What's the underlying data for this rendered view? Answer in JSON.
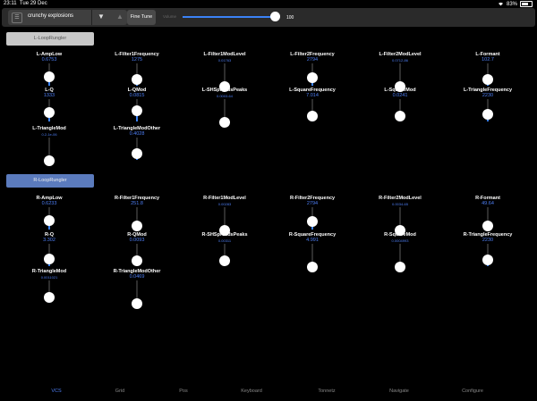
{
  "status_bar": {
    "time": "23:11",
    "date": "Tue 29 Dec",
    "battery": "83%"
  },
  "toolbar": {
    "preset_name": "crunchy explosions",
    "fine_tune_label": "Fine Tune",
    "slider_label": "Volume",
    "slider_value": "100",
    "slider_fraction": 1.0
  },
  "sections": {
    "left_button": "L-LoopRungler",
    "right_button": "R-LoopRungler"
  },
  "knobs_left": [
    {
      "label": "L-AmpLow",
      "value": "0.6753",
      "level": 0.5,
      "small": false
    },
    {
      "label": "L-Filter1Frequency",
      "value": "1275",
      "level": 0.35,
      "small": false
    },
    {
      "label": "L-Filter1ModLevel",
      "value": "0.01763",
      "level": 0.0,
      "small": true
    },
    {
      "label": "L-Filter2Frequency",
      "value": "2794",
      "level": 0.45,
      "small": false
    },
    {
      "label": "L-Filter2ModLevel",
      "value": "0.0712-86",
      "level": 0.0,
      "small": true
    },
    {
      "label": "L-Formant",
      "value": "102.7",
      "level": 0.35,
      "small": false
    },
    {
      "label": "L-Q",
      "value": "1333",
      "level": 0.5,
      "small": false
    },
    {
      "label": "L-QMod",
      "value": "0.0815",
      "level": 0.6,
      "small": false
    },
    {
      "label": "L-SHSpreadsPeaks",
      "value": "0.0003-64",
      "level": 0.0,
      "small": true
    },
    {
      "label": "L-SquareFrequency",
      "value": "7.014",
      "level": 0.3,
      "small": false
    },
    {
      "label": "L-SquareMod",
      "value": "0.0241",
      "level": 0.3,
      "small": false
    },
    {
      "label": "L-TriangleFrequency",
      "value": "2230",
      "level": 0.4,
      "small": false
    },
    {
      "label": "L-TriangleMod",
      "value": "0.2-1e-06",
      "level": 0.0,
      "small": true
    },
    {
      "label": "L-TriangleModOther",
      "value": "0.4028",
      "level": 0.35,
      "small": false
    }
  ],
  "knobs_right": [
    {
      "label": "R-AmpLow",
      "value": "0.6233",
      "level": 0.5,
      "small": false
    },
    {
      "label": "R-Filter1Frequency",
      "value": "251.8",
      "level": 0.25,
      "small": false
    },
    {
      "label": "R-Filter1ModLevel",
      "value": "0.00283",
      "level": 0.0,
      "small": true
    },
    {
      "label": "R-Filter2Frequency",
      "value": "2794",
      "level": 0.45,
      "small": false
    },
    {
      "label": "R-Filter2ModLevel",
      "value": "0.0034-65",
      "level": 0.0,
      "small": true
    },
    {
      "label": "R-Formant",
      "value": "49.64",
      "level": 0.25,
      "small": false
    },
    {
      "label": "R-Q",
      "value": "3.302",
      "level": 0.4,
      "small": false
    },
    {
      "label": "R-QMod",
      "value": "0.0093",
      "level": 0.3,
      "small": false
    },
    {
      "label": "R-SHSpreadsPeaks",
      "value": "0.00311",
      "level": 0.3,
      "small": true
    },
    {
      "label": "R-SquareFrequency",
      "value": "4.991",
      "level": 0.0,
      "small": false
    },
    {
      "label": "R-SquareMod",
      "value": "0.0004993",
      "level": 0.0,
      "small": true
    },
    {
      "label": "R-TriangleFrequency",
      "value": "2230",
      "level": 0.35,
      "small": false
    },
    {
      "label": "R-TriangleMod",
      "value": "0.0011021",
      "level": 0.3,
      "small": true
    },
    {
      "label": "R-TriangleModOther",
      "value": "0.0469",
      "level": 0.0,
      "small": false
    }
  ],
  "tabs": [
    {
      "label": "VCS",
      "active": true
    },
    {
      "label": "Grid",
      "active": false
    },
    {
      "label": "Pos",
      "active": false
    },
    {
      "label": "Keyboard",
      "active": false
    },
    {
      "label": "Tonnetz",
      "active": false
    },
    {
      "label": "Navigate",
      "active": false
    },
    {
      "label": "Configure",
      "active": false
    }
  ],
  "colors": {
    "accent": "#3b82f6",
    "value_text": "#4e7ff5",
    "background": "#000000"
  }
}
